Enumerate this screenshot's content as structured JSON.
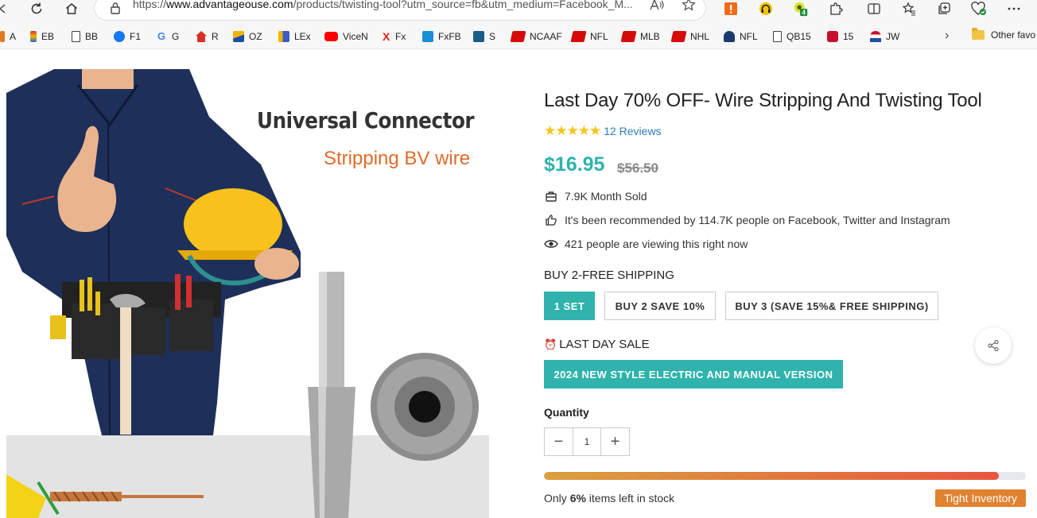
{
  "browser": {
    "url_prefix": "https://",
    "url_host": "www.advantageouse.com",
    "url_path": "/products/twisting-tool?utm_source=fb&utm_medium=Facebook_M...",
    "extension_badge": "4"
  },
  "favorites": {
    "items": [
      {
        "label": "A",
        "icon": "favicon-a",
        "color": "#e07a1f"
      },
      {
        "label": "EB",
        "icon": "favicon-eb",
        "color": "#d9362b"
      },
      {
        "label": "BB",
        "icon": "page-icon",
        "color": "#444444"
      },
      {
        "label": "F1",
        "icon": "facebook-icon",
        "color": "#1877f2"
      },
      {
        "label": "G",
        "icon": "google-icon",
        "color": "#4285f4"
      },
      {
        "label": "R",
        "icon": "home-icon",
        "color": "#d93025"
      },
      {
        "label": "OZ",
        "icon": "favicon-oz",
        "color": "#f0b400"
      },
      {
        "label": "LEx",
        "icon": "favicon-lex",
        "color": "#3a5cc9"
      },
      {
        "label": "ViceN",
        "icon": "youtube-icon",
        "color": "#ff0000"
      },
      {
        "label": "Fx",
        "icon": "favicon-fx",
        "color": "#e1251b"
      },
      {
        "label": "FxFB",
        "icon": "favicon-fxfb",
        "color": "#1a8fd8"
      },
      {
        "label": "S",
        "icon": "favicon-s",
        "color": "#1a5d8a"
      },
      {
        "label": "NCAAF",
        "icon": "espn-icon",
        "color": "#d50a0a"
      },
      {
        "label": "NFL",
        "icon": "espn-icon",
        "color": "#d50a0a"
      },
      {
        "label": "MLB",
        "icon": "espn-icon",
        "color": "#d50a0a"
      },
      {
        "label": "NHL",
        "icon": "espn-icon",
        "color": "#d50a0a"
      },
      {
        "label": "NFL",
        "icon": "favicon-nfl",
        "color": "#1d3a6e"
      },
      {
        "label": "QB15",
        "icon": "page-icon",
        "color": "#444444"
      },
      {
        "label": "15",
        "icon": "favicon-15",
        "color": "#c8102e"
      },
      {
        "label": "JW",
        "icon": "favicon-jw",
        "color": "#1f4e9c"
      }
    ],
    "other_label": "Other favo"
  },
  "product_image": {
    "headline": "Universal Connector",
    "subheadline": "Stripping BV wire"
  },
  "product": {
    "title": "Last Day 70% OFF- Wire Stripping And Twisting Tool",
    "stars": "★★★★★",
    "reviews": "12 Reviews",
    "price": "$16.95",
    "compare_price": "$56.50",
    "sold": "7.9K Month Sold",
    "recommended": "It's been recommended by 114.7K people on Facebook, Twitter and Instagram",
    "viewing": "421 people are viewing this right now"
  },
  "bundle": {
    "label": "BUY 2-FREE SHIPPING",
    "options": [
      "1 SET",
      "BUY 2 SAVE 10%",
      "BUY 3 (SAVE 15%& FREE SHIPPING)"
    ],
    "selected_index": 0
  },
  "sale": {
    "icon": "⏰",
    "label": "LAST DAY SALE",
    "version": "2024 NEW STYLE ELECTRIC AND MANUAL VERSION"
  },
  "quantity": {
    "label": "Quantity",
    "value": "1",
    "minus": "−",
    "plus": "+"
  },
  "stock": {
    "prefix": "Only ",
    "percent": "6%",
    "suffix": " items left in stock",
    "bar_fraction": 0.944,
    "badge": "Tight Inventory"
  },
  "colors": {
    "accent": "#2fb3ac",
    "badge": "#e0822f",
    "link": "#2a7fb8",
    "star": "#f5c518"
  }
}
